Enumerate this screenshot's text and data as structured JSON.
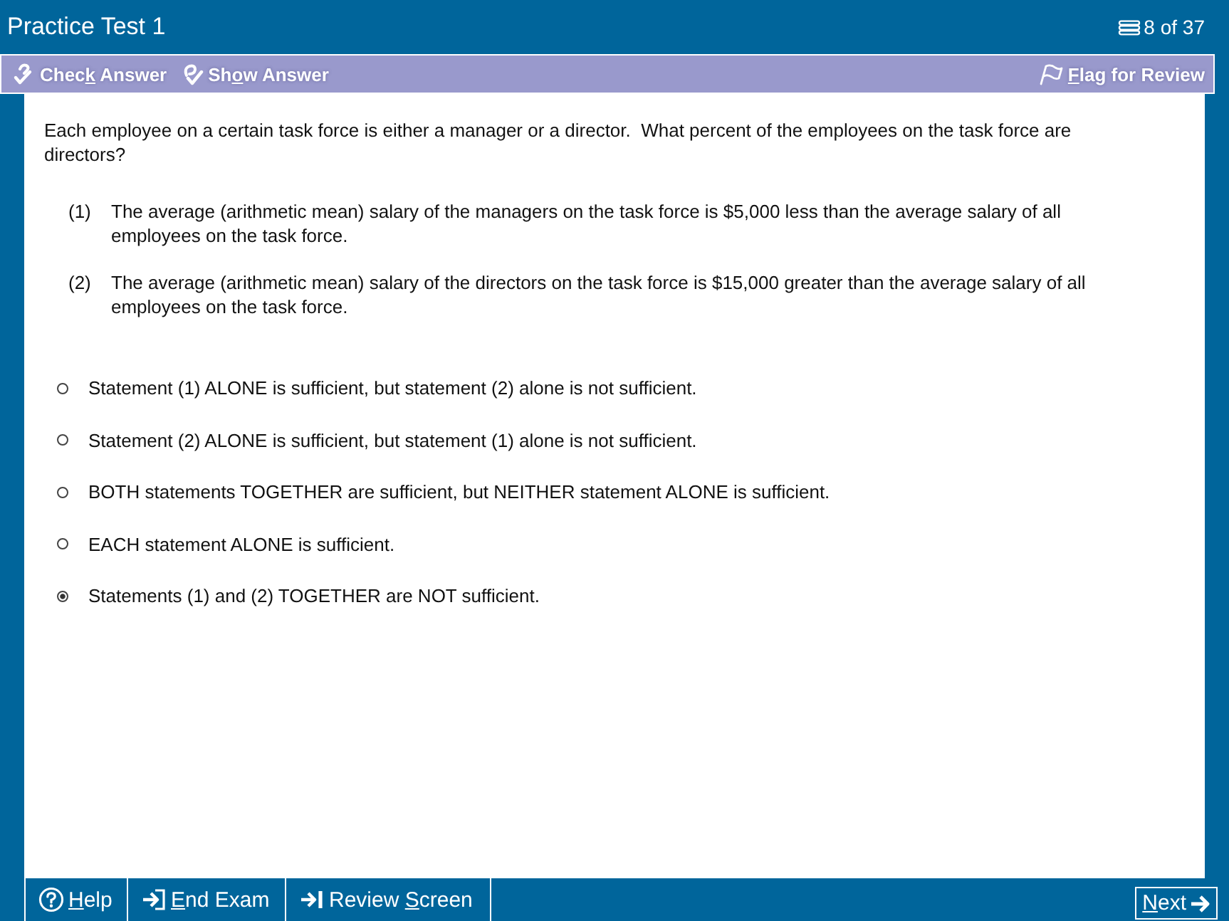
{
  "window": {
    "title": "Practice Test 1",
    "counter": "8 of 37"
  },
  "toolbar": {
    "check_answer": {
      "before": "Chec",
      "key": "k",
      "after": " Answer"
    },
    "show_answer": {
      "before": "Sh",
      "key": "o",
      "after": "w Answer"
    },
    "flag_for_review": {
      "key": "F",
      "after": "lag for Review"
    }
  },
  "question": {
    "stem": "Each employee on a certain task force is either a manager or a director.  What percent of the employees on the task force are directors?",
    "statements": [
      {
        "number": "(1)",
        "text": "The average (arithmetic mean) salary of the managers on the task force is $5,000 less than the average salary of all employees on the task force."
      },
      {
        "number": "(2)",
        "text": "The average (arithmetic mean) salary of the directors on the task force is $15,000 greater than the average salary of all employees on the task force."
      }
    ]
  },
  "options": [
    {
      "text": "Statement (1) ALONE is sufficient, but statement (2) alone is not sufficient.",
      "selected": false
    },
    {
      "text": "Statement (2) ALONE is sufficient, but statement (1) alone is not sufficient.",
      "selected": false
    },
    {
      "text": "BOTH statements TOGETHER are sufficient, but NEITHER statement ALONE is sufficient.",
      "selected": false
    },
    {
      "text": "EACH statement ALONE is sufficient.",
      "selected": false
    },
    {
      "text": "Statements (1) and (2) TOGETHER are NOT sufficient.",
      "selected": true
    }
  ],
  "footer": {
    "help": {
      "key": "H",
      "after": "elp"
    },
    "end_exam": {
      "key": "E",
      "after": "nd Exam"
    },
    "review_screen": {
      "before": "Review ",
      "key": "S",
      "after": "creen"
    },
    "next": {
      "key": "N",
      "after": "ext"
    }
  }
}
